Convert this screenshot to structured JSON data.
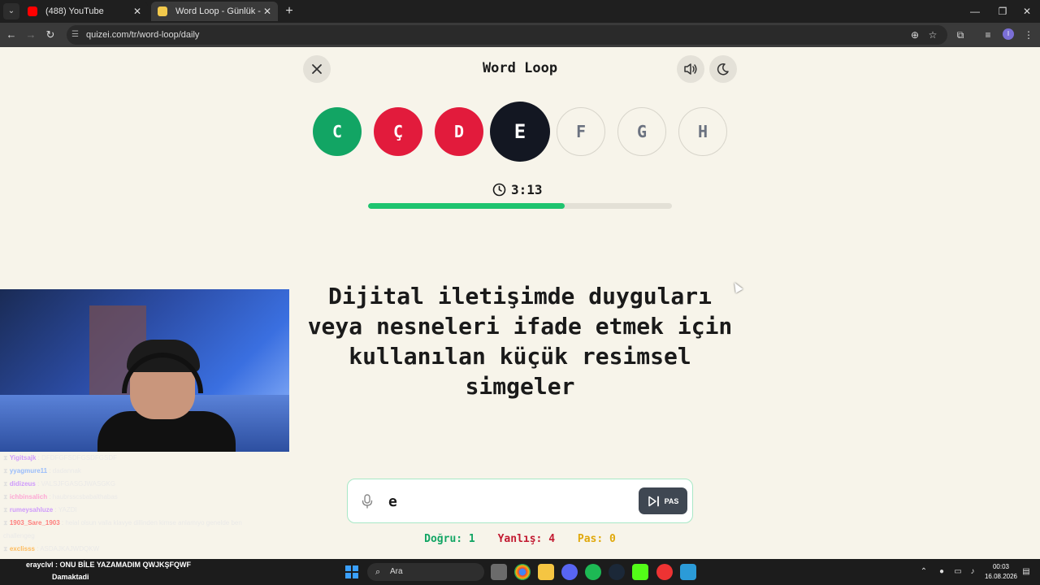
{
  "browser": {
    "tabs": [
      {
        "label": "(488) YouTube",
        "close": "✕"
      },
      {
        "label": "Word Loop - Günlük - Quizei",
        "close": "✕"
      }
    ],
    "url": "quizei.com/tr/word-loop/daily"
  },
  "game": {
    "title": "Word Loop",
    "letters": [
      {
        "char": "C",
        "state": "correct"
      },
      {
        "char": "Ç",
        "state": "wrong"
      },
      {
        "char": "D",
        "state": "wrong"
      },
      {
        "char": "E",
        "state": "current"
      },
      {
        "char": "F",
        "state": "pending"
      },
      {
        "char": "G",
        "state": "pending"
      },
      {
        "char": "H",
        "state": "pending"
      }
    ],
    "timer": "3:13",
    "progress_fraction": 0.646,
    "question": "Dijital iletişimde duyguları veya nesneleri ifade etmek için kullanılan küçük resimsel simgeler",
    "answer_value": "e",
    "pass_label": "PAS",
    "stats": {
      "correct": "Doğru: 1",
      "wrong": "Yanlış: 4",
      "passed": "Pas: 0"
    }
  },
  "chat": [
    {
      "user": "Yigitsajk",
      "color": "#c98cff",
      "message": "DFDFGFSDFGSDFGSDF"
    },
    {
      "user": "yyagmure11",
      "color": "#8ab4ff",
      "message": "dadannak"
    },
    {
      "user": "didizeus",
      "color": "#c98cff",
      "message": "VALSJFGASGJWASGKG"
    },
    {
      "user": "ichbinsalich",
      "color": "#ff9ad1",
      "message": "haubrsscsbabalthabas"
    },
    {
      "user": "rumeysahluze",
      "color": "#c98cff",
      "message": "YAZDI"
    },
    {
      "user": "1903_Sare_1903",
      "color": "#ff6b6b",
      "message": "helal olsun valla klavye dillinden kimse anlamıyo genelde ben"
    },
    {
      "user": "",
      "color": "#ddd",
      "message": "challengeg"
    },
    {
      "user": "exclisss",
      "color": "#ffb347",
      "message": "ASDAJKAJWDQKW"
    }
  ],
  "notification": {
    "line1": "erayclvl : ONU BİLE YAZAMADIM QWJKŞFQWF",
    "line2": "Damaktadi"
  },
  "taskbar": {
    "search_label": "Ara",
    "time": "00:03",
    "date": "16.08.2026"
  },
  "colors": {
    "correct": "#12a564",
    "wrong": "#e21b3c",
    "current": "#131722",
    "progress": "#1ec46f",
    "pass_button": "#3f4752"
  }
}
